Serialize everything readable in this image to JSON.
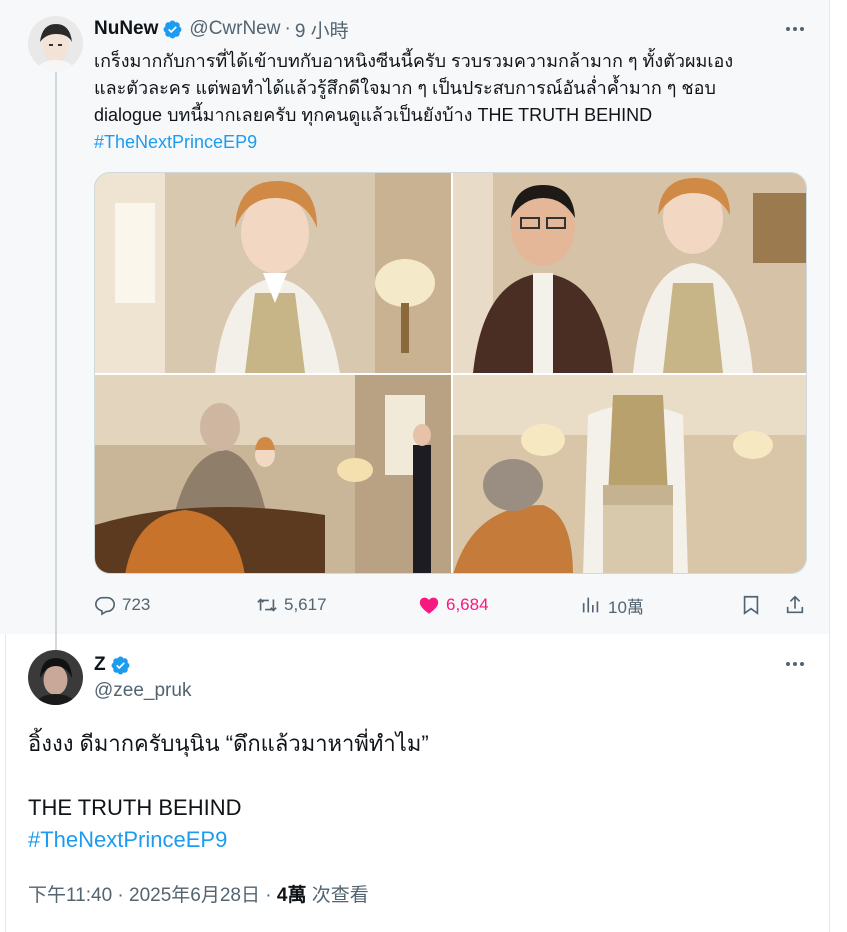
{
  "parent_tweet": {
    "display_name": "NuNew",
    "handle": "@CwrNew",
    "separator": "·",
    "time": "9 小時",
    "verified_color": "#1d9bf0",
    "text_lines": [
      "เกร็งมากกับการที่ได้เข้าบทกับอาหนิงซีนนี้ครับ รวบรวมความกล้ามาก ๆ ทั้งตัวผมเอง",
      "และตัวละคร แต่พอทำได้แล้วรู้สึกดีใจมาก ๆ เป็นประสบการณ์อันล่ำค้ำมาก ๆ ชอบ",
      "dialogue บทนี้มากเลยครับ ทุกคนดูแล้วเป็นยังบ้าง THE TRUTH BEHIND"
    ],
    "hashtag": "#TheNextPrinceEP9",
    "media_count": 4,
    "stats": {
      "replies": "723",
      "retweets": "5,617",
      "likes": "6,684",
      "views": "10萬"
    },
    "icons": [
      "reply-icon",
      "retweet-icon",
      "like-icon",
      "views-icon",
      "bookmark-icon",
      "share-icon",
      "more-icon",
      "verified-icon"
    ],
    "like_color": "#f91880"
  },
  "main_tweet": {
    "display_name": "Z",
    "handle": "@zee_pruk",
    "text_lines": [
      "อิ้งงง ดีมากครับนุนิน “ดึกแล้วมาหาพี่ทำไม”",
      "",
      "THE TRUTH BEHIND"
    ],
    "hashtag": "#TheNextPrinceEP9",
    "timestamp": "下午11:40 · 2025年6月28日 · ",
    "views_count": "4萬",
    "views_label": " 次查看"
  },
  "colors": {
    "link": "#1d9bf0",
    "secondary_text": "#536471",
    "primary_text": "#0f1419"
  }
}
